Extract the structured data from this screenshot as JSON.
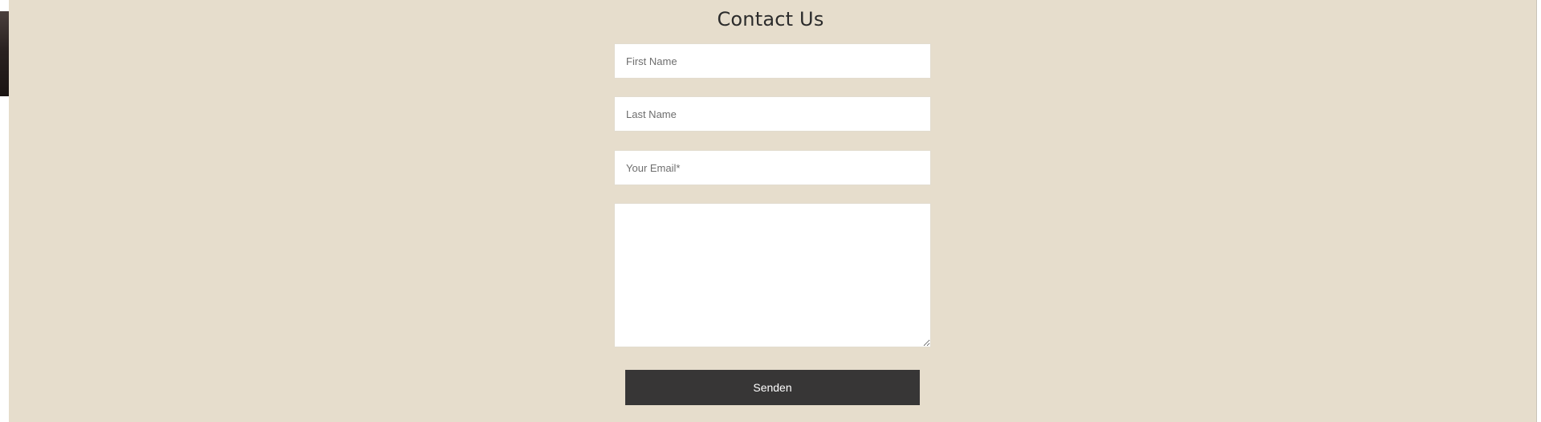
{
  "form": {
    "title": "Contact Us",
    "first_name_placeholder": "First Name",
    "last_name_placeholder": "Last Name",
    "email_placeholder": "Your Email*",
    "message_placeholder": "",
    "submit_label": "Senden"
  },
  "colors": {
    "section_background": "#e6ddcc",
    "button_background": "#373636",
    "button_text": "#ffffff",
    "title_text": "#2b2b2b"
  }
}
